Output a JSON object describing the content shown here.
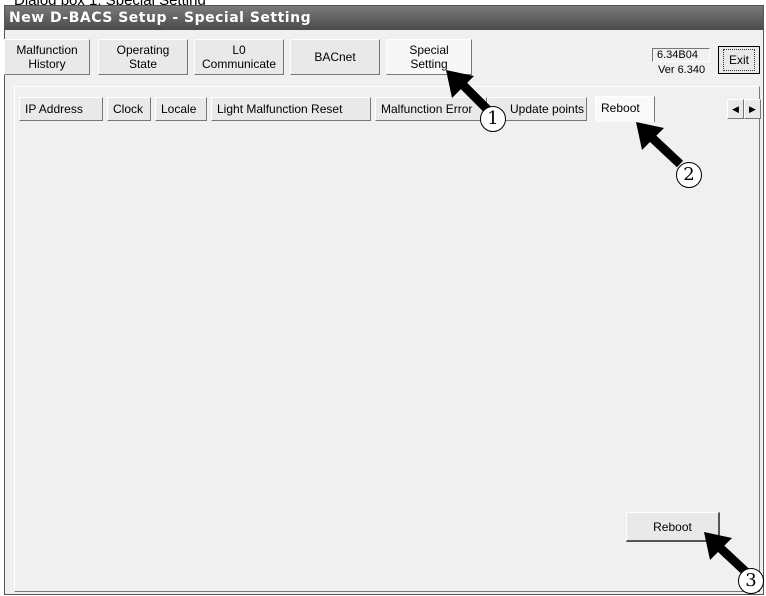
{
  "caption": "Dialog box 1: Special Setting",
  "window": {
    "title": "New D-BACS Setup - Special Setting"
  },
  "main_tabs": [
    {
      "label": "Malfunction\nHistory"
    },
    {
      "label": "Operating\nState"
    },
    {
      "label": "L0\nCommunicate"
    },
    {
      "label": "BACnet"
    },
    {
      "label": "Special\nSetting"
    }
  ],
  "version": {
    "build": "6.34B04",
    "ver": "Ver 6.340"
  },
  "exit_label": "Exit",
  "sub_tabs": [
    {
      "label": "IP Address"
    },
    {
      "label": "Clock"
    },
    {
      "label": "Locale"
    },
    {
      "label": "Light Malfunction Reset"
    },
    {
      "label": "Malfunction Error"
    },
    {
      "label": "Update points"
    },
    {
      "label": "Reboot"
    }
  ],
  "scroll": {
    "left": "◀",
    "right": "▶"
  },
  "reboot_button": "Reboot",
  "callouts": [
    "1",
    "2",
    "3"
  ]
}
